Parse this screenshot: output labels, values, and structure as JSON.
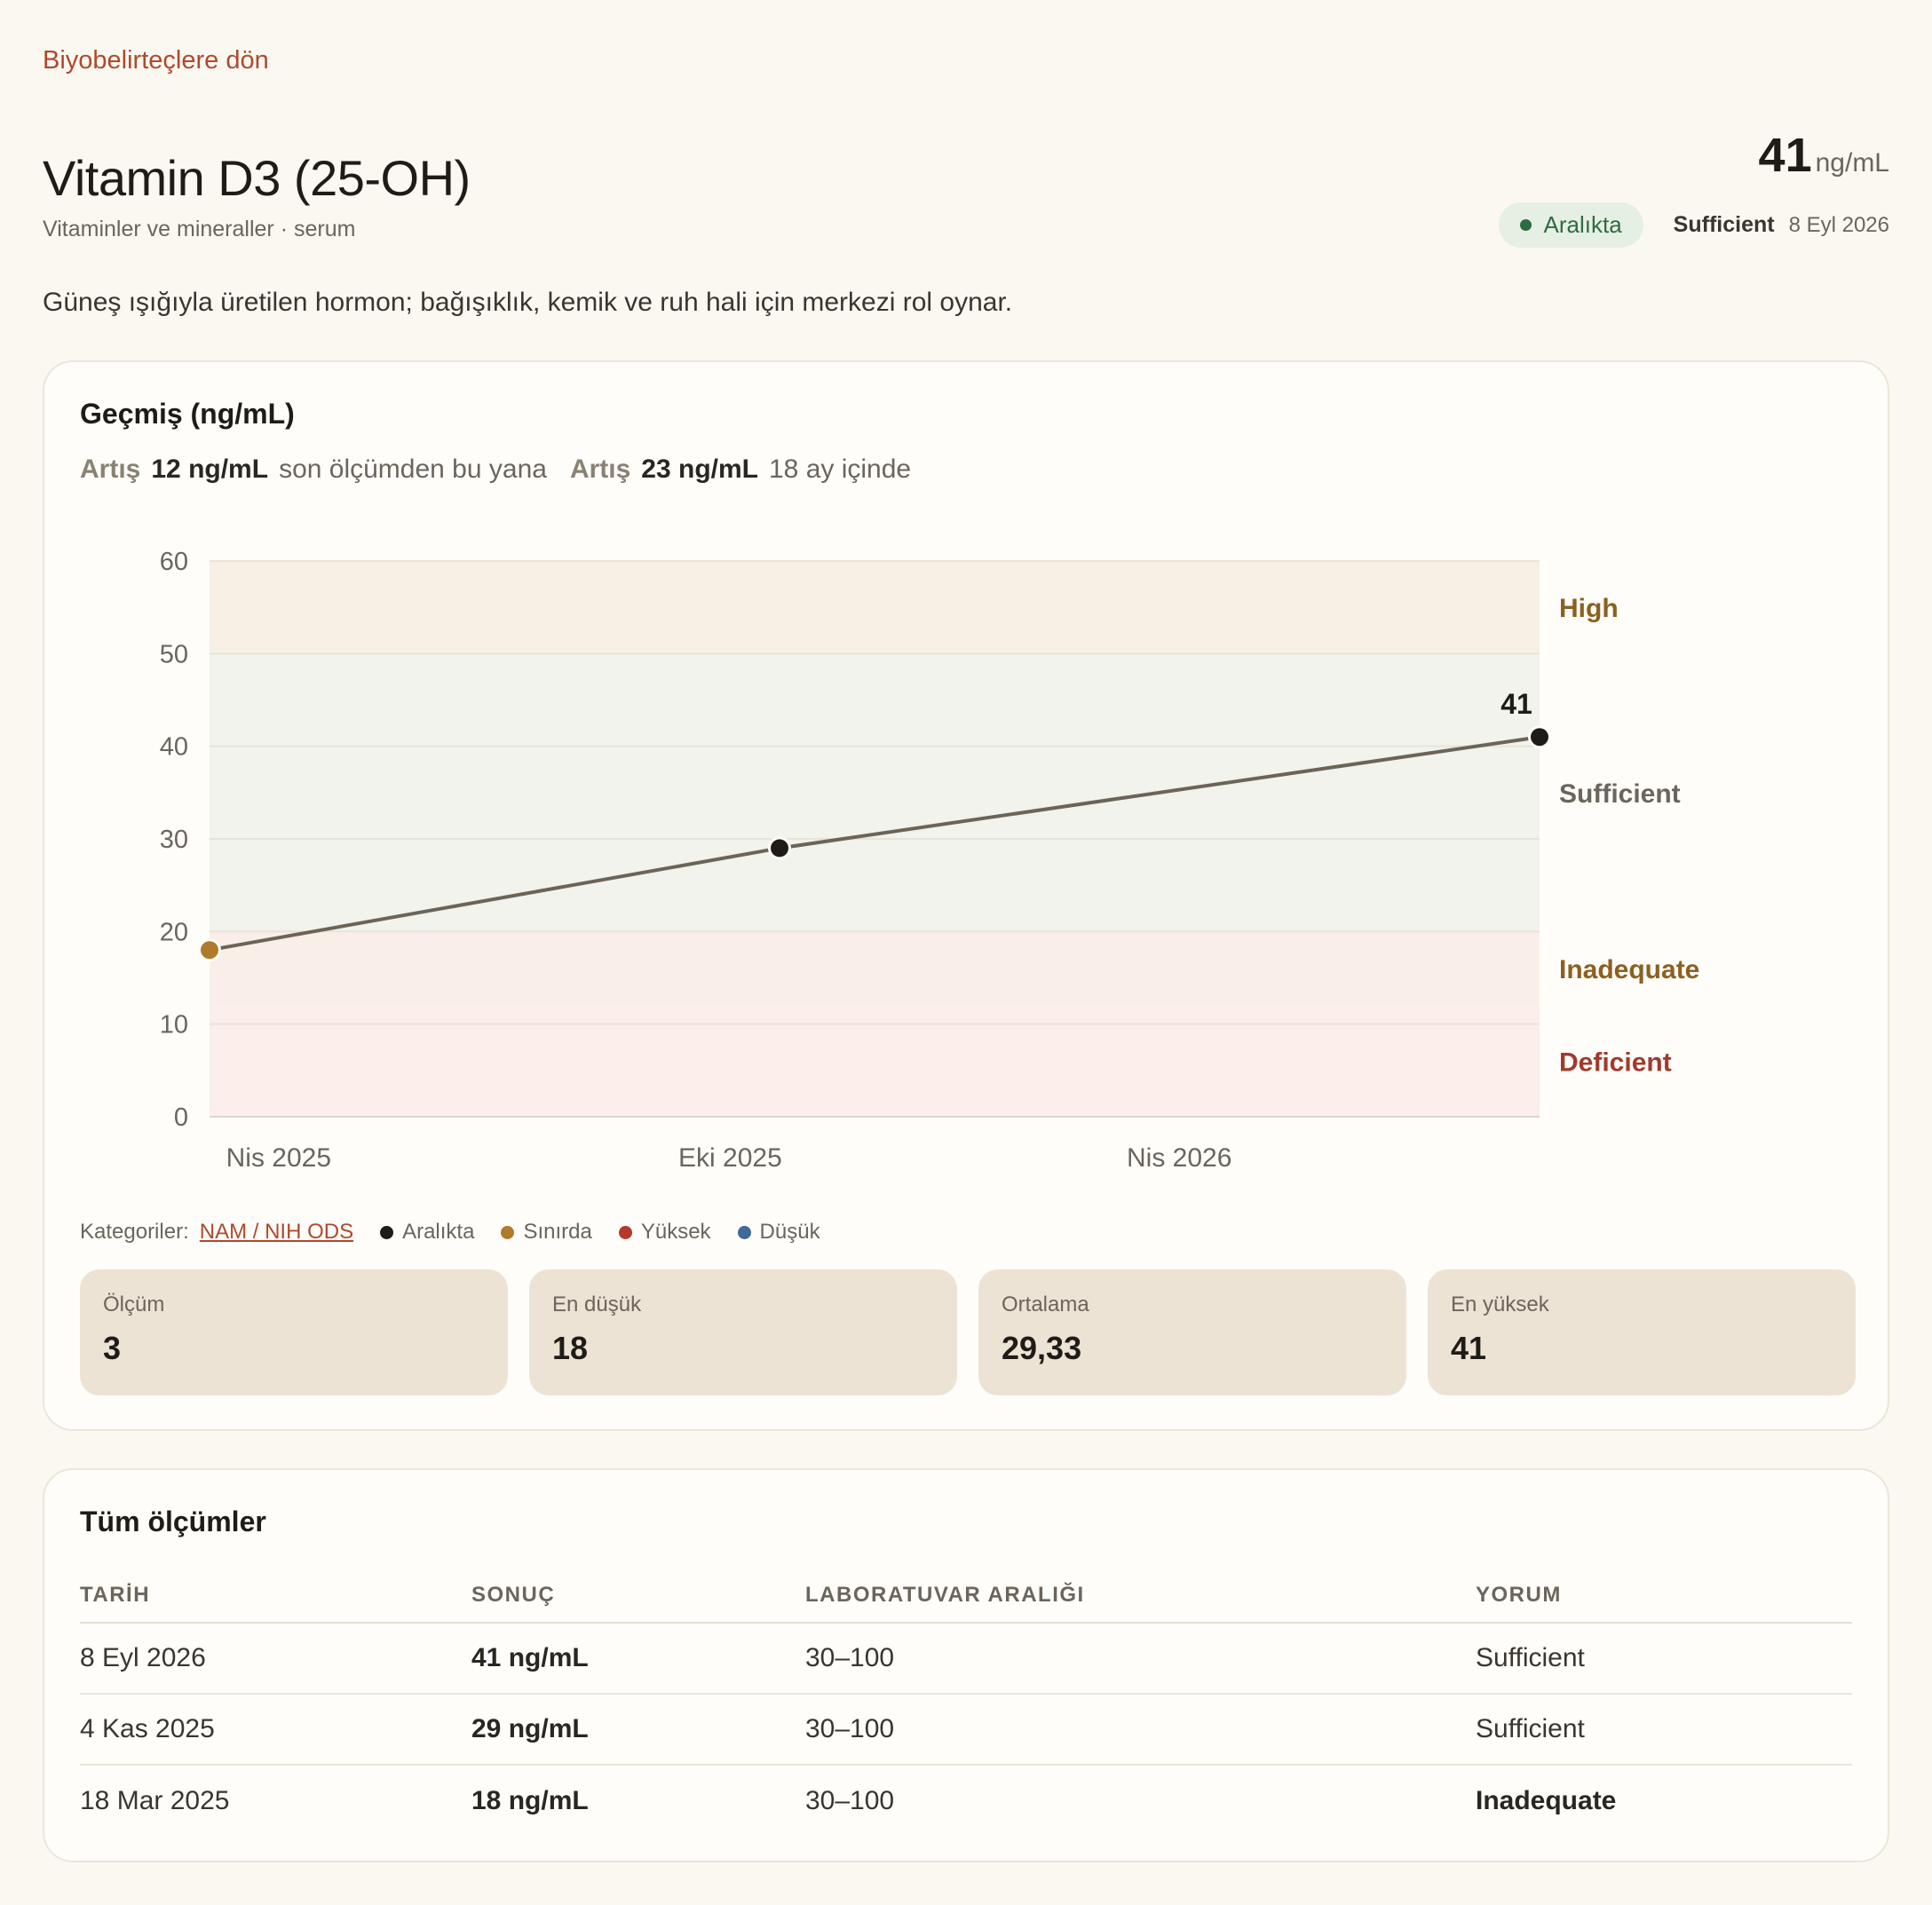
{
  "nav": {
    "back_label": "Biyobelirteçlere dön"
  },
  "header": {
    "title": "Vitamin D3 (25-OH)",
    "subtitle": "Vitaminler ve mineraller · serum",
    "value": "41",
    "unit": "ng/mL",
    "status_pill": "Aralıkta",
    "status_label": "Sufficient",
    "status_date": "8 Eyl 2026"
  },
  "description": "Güneş ışığıyla üretilen hormon; bağışıklık, kemik ve ruh hali için merkezi rol oynar.",
  "history": {
    "title": "Geçmiş (ng/mL)",
    "trend": [
      {
        "keyword": "Artış",
        "amount": "12 ng/mL",
        "suffix": "son ölçümden bu yana"
      },
      {
        "keyword": "Artış",
        "amount": "23 ng/mL",
        "suffix": "18 ay içinde"
      }
    ]
  },
  "chart_data": {
    "type": "line",
    "ylabel": "",
    "xlabel": "",
    "ylim": [
      0,
      60
    ],
    "yticks": [
      0,
      10,
      20,
      30,
      40,
      50,
      60
    ],
    "xlim": [
      "2025-03-18",
      "2026-09-08"
    ],
    "xticks": [
      {
        "date": "2025-04-15",
        "label": "Nis 2025"
      },
      {
        "date": "2025-10-15",
        "label": "Eki 2025"
      },
      {
        "date": "2026-04-15",
        "label": "Nis 2026"
      }
    ],
    "bands": [
      {
        "label": "Deficient",
        "from": 0,
        "to": 12,
        "fill": "#fbeeeb",
        "text_color": "#a13a2c"
      },
      {
        "label": "Inadequate",
        "from": 12,
        "to": 20,
        "fill": "#faefe8",
        "text_color": "#8c6020"
      },
      {
        "label": "Sufficient",
        "from": 20,
        "to": 50,
        "fill": "#f1f3ec",
        "text_color": "#6b655c"
      },
      {
        "label": "High",
        "from": 50,
        "to": 60,
        "fill": "#f8f0e5",
        "text_color": "#8c6020"
      }
    ],
    "series": [
      {
        "points": [
          {
            "x": "2025-03-18",
            "y": 18,
            "color": "#b07a2a"
          },
          {
            "x": "2025-11-04",
            "y": 29,
            "color": "#1f1c18"
          },
          {
            "x": "2026-09-08",
            "y": 41,
            "color": "#1f1c18",
            "label": "41"
          }
        ],
        "line_color": "#6b6458"
      }
    ],
    "legend": "bottom-left"
  },
  "legend": {
    "prefix": "Kategoriler:",
    "source": "NAM / NIH ODS",
    "items": [
      {
        "label": "Aralıkta",
        "color": "#1f1c18"
      },
      {
        "label": "Sınırda",
        "color": "#b07a2a"
      },
      {
        "label": "Yüksek",
        "color": "#b5392c"
      },
      {
        "label": "Düşük",
        "color": "#3d6a99"
      }
    ]
  },
  "stats": [
    {
      "label": "Ölçüm",
      "value": "3"
    },
    {
      "label": "En düşük",
      "value": "18"
    },
    {
      "label": "Ortalama",
      "value": "29,33"
    },
    {
      "label": "En yüksek",
      "value": "41"
    }
  ],
  "measurements": {
    "title": "Tüm ölçümler",
    "columns": [
      "TARİH",
      "SONUÇ",
      "LABORATUVAR ARALIĞI",
      "YORUM"
    ],
    "rows": [
      {
        "date": "8 Eyl 2026",
        "result": "41 ng/mL",
        "range": "30–100",
        "interpretation": "Sufficient"
      },
      {
        "date": "4 Kas 2025",
        "result": "29 ng/mL",
        "range": "30–100",
        "interpretation": "Sufficient"
      },
      {
        "date": "18 Mar 2025",
        "result": "18 ng/mL",
        "range": "30–100",
        "interpretation": "Inadequate"
      }
    ]
  }
}
